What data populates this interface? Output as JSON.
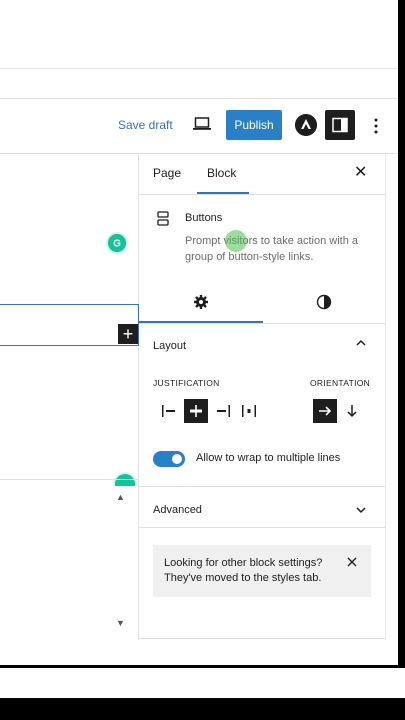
{
  "topbar": {
    "save_draft": "Save draft",
    "publish": "Publish"
  },
  "sidebar": {
    "tabs": [
      {
        "label": "Page"
      },
      {
        "label": "Block"
      }
    ],
    "active_tab": "Block",
    "block": {
      "title": "Buttons",
      "description": "Prompt visitors to take action with a group of button-style links."
    },
    "layout": {
      "label": "Layout",
      "justification_label": "JUSTIFICATION",
      "orientation_label": "ORIENTATION",
      "justification_active": "center",
      "orientation_active": "horizontal"
    },
    "wrap_toggle": {
      "label": "Allow to wrap to multiple lines",
      "on": true
    },
    "advanced": {
      "label": "Advanced"
    },
    "notice": {
      "text": "Looking for other block settings? They've moved to the styles tab."
    }
  },
  "colors": {
    "accent": "#2980c7",
    "link": "#3872b0",
    "dark": "#1e1e1e"
  }
}
